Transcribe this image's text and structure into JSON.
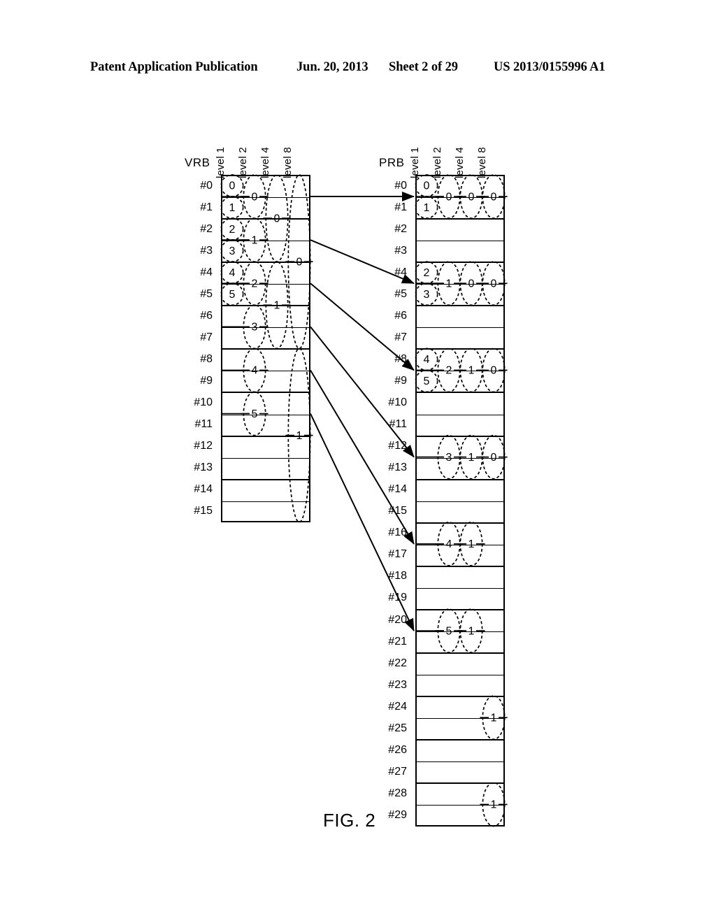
{
  "header": {
    "publication": "Patent Application Publication",
    "date": "Jun. 20, 2013",
    "sheet": "Sheet 2 of 29",
    "patent_number": "US 2013/0155996 A1"
  },
  "figure": {
    "caption": "FIG. 2"
  },
  "column_headers": [
    "level 1",
    "level 2",
    "level 4",
    "level 8"
  ],
  "vrb": {
    "title": "VRB",
    "rows": [
      "#0",
      "#1",
      "#2",
      "#3",
      "#4",
      "#5",
      "#6",
      "#7",
      "#8",
      "#9",
      "#10",
      "#11",
      "#12",
      "#13",
      "#14",
      "#15"
    ],
    "level1_ellipses": [
      {
        "row": 0,
        "label": "0"
      },
      {
        "row": 1,
        "label": "1"
      },
      {
        "row": 2,
        "label": "2"
      },
      {
        "row": 3,
        "label": "3"
      },
      {
        "row": 4,
        "label": "4"
      },
      {
        "row": 5,
        "label": "5"
      }
    ],
    "level2_ellipses": [
      {
        "rows": [
          0,
          1
        ],
        "label": "0"
      },
      {
        "rows": [
          2,
          3
        ],
        "label": "1"
      },
      {
        "rows": [
          4,
          5
        ],
        "label": "2"
      },
      {
        "rows": [
          6,
          7
        ],
        "label": "3"
      },
      {
        "rows": [
          8,
          9
        ],
        "label": "4"
      },
      {
        "rows": [
          10,
          11
        ],
        "label": "5"
      }
    ],
    "level4_ellipses": [
      {
        "rows": [
          0,
          3
        ],
        "label": "0"
      },
      {
        "rows": [
          4,
          7
        ],
        "label": "1"
      }
    ],
    "level8_ellipses": [
      {
        "rows": [
          0,
          7
        ],
        "label": "0"
      },
      {
        "rows": [
          8,
          15
        ],
        "label": "1"
      }
    ]
  },
  "prb": {
    "title": "PRB",
    "rows": [
      "#0",
      "#1",
      "#2",
      "#3",
      "#4",
      "#5",
      "#6",
      "#7",
      "#8",
      "#9",
      "#10",
      "#11",
      "#12",
      "#13",
      "#14",
      "#15",
      "#16",
      "#17",
      "#18",
      "#19",
      "#20",
      "#21",
      "#22",
      "#23",
      "#24",
      "#25",
      "#26",
      "#27",
      "#28",
      "#29"
    ],
    "level1_ellipses": [
      {
        "row": 0,
        "label": "0"
      },
      {
        "row": 1,
        "label": "1"
      },
      {
        "row": 4,
        "label": "2"
      },
      {
        "row": 5,
        "label": "3"
      },
      {
        "row": 8,
        "label": "4"
      },
      {
        "row": 9,
        "label": "5"
      }
    ],
    "level2_ellipses": [
      {
        "rows": [
          0,
          1
        ],
        "label": "0"
      },
      {
        "rows": [
          4,
          5
        ],
        "label": "1"
      },
      {
        "rows": [
          8,
          9
        ],
        "label": "2"
      },
      {
        "rows": [
          12,
          13
        ],
        "label": "3"
      },
      {
        "rows": [
          16,
          17
        ],
        "label": "4"
      },
      {
        "rows": [
          20,
          21
        ],
        "label": "5"
      }
    ],
    "level4_ellipses": [
      {
        "rows": [
          0,
          1
        ],
        "label": "0"
      },
      {
        "rows": [
          4,
          5
        ],
        "label": "0"
      },
      {
        "rows": [
          8,
          9
        ],
        "label": "1"
      },
      {
        "rows": [
          12,
          13
        ],
        "label": "1"
      },
      {
        "rows": [
          16,
          17
        ],
        "label": "1"
      },
      {
        "rows": [
          20,
          21
        ],
        "label": "1"
      }
    ],
    "level8_ellipses": [
      {
        "rows": [
          0,
          1
        ],
        "label": "0"
      },
      {
        "rows": [
          4,
          5
        ],
        "label": "0"
      },
      {
        "rows": [
          8,
          9
        ],
        "label": "0"
      },
      {
        "rows": [
          12,
          13
        ],
        "label": "0"
      },
      {
        "rows": [
          24,
          25
        ],
        "label": "1"
      },
      {
        "rows": [
          28,
          29
        ],
        "label": "1"
      }
    ]
  },
  "mappings": [
    {
      "from_vrb_row": 0,
      "to_prb_row": 0
    },
    {
      "from_vrb_row": 2,
      "to_prb_row": 4
    },
    {
      "from_vrb_row": 4,
      "to_prb_row": 8
    },
    {
      "from_vrb_row": 6,
      "to_prb_row": 12
    },
    {
      "from_vrb_row": 8,
      "to_prb_row": 16
    },
    {
      "from_vrb_row": 10,
      "to_prb_row": 20
    }
  ],
  "colors": {
    "line": "#000000",
    "background": "#ffffff"
  }
}
